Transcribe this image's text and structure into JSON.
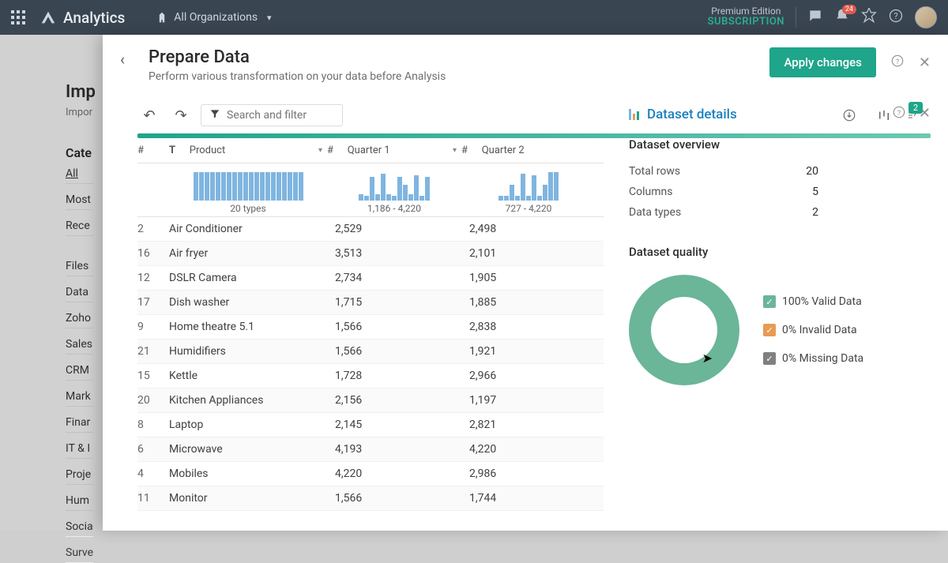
{
  "topnav": {
    "product": "Analytics",
    "org_label": "All Organizations",
    "edition_a": "Premium Edition",
    "edition_b": "SUBSCRIPTION",
    "notif_count": "24"
  },
  "bg": {
    "title": "Imp",
    "sub": "Impor",
    "cat": "Cate",
    "items": [
      "All",
      "Most",
      "Rece",
      "Files",
      "Data",
      "Zoho",
      "Sales",
      "CRM",
      "Mark",
      "Finar",
      "IT & I",
      "Proje",
      "Hum",
      "Socia",
      "Surve"
    ]
  },
  "panel": {
    "title": "Prepare Data",
    "subtitle": "Perform various transformation on your data before Analysis",
    "apply": "Apply changes",
    "search_placeholder": "Search and filter",
    "badge": "2"
  },
  "table": {
    "cols": {
      "idx": "#",
      "type": "T",
      "product": "Product",
      "q1": "Quarter 1",
      "q2": "Quarter 2"
    },
    "hist": {
      "c1": "20 types",
      "c2": "1,186 - 4,220",
      "c3": "727 - 4,220"
    },
    "rows": [
      {
        "n": "2",
        "p": "Air Conditioner",
        "q1": "2,529",
        "q2": "2,498"
      },
      {
        "n": "16",
        "p": "Air fryer",
        "q1": "3,513",
        "q2": "2,101"
      },
      {
        "n": "12",
        "p": "DSLR Camera",
        "q1": "2,734",
        "q2": "1,905"
      },
      {
        "n": "17",
        "p": "Dish washer",
        "q1": "1,715",
        "q2": "1,885"
      },
      {
        "n": "9",
        "p": "Home theatre 5.1",
        "q1": "1,566",
        "q2": "2,838"
      },
      {
        "n": "21",
        "p": "Humidifiers",
        "q1": "1,566",
        "q2": "1,921"
      },
      {
        "n": "15",
        "p": "Kettle",
        "q1": "1,728",
        "q2": "2,966"
      },
      {
        "n": "20",
        "p": "Kitchen Appliances",
        "q1": "2,156",
        "q2": "1,197"
      },
      {
        "n": "8",
        "p": "Laptop",
        "q1": "2,145",
        "q2": "2,821"
      },
      {
        "n": "6",
        "p": "Microwave",
        "q1": "4,193",
        "q2": "4,220"
      },
      {
        "n": "4",
        "p": "Mobiles",
        "q1": "4,220",
        "q2": "2,986"
      },
      {
        "n": "11",
        "p": "Monitor",
        "q1": "1,566",
        "q2": "1,744"
      }
    ]
  },
  "details": {
    "title": "Dataset details",
    "overview": "Dataset overview",
    "stats": [
      {
        "k": "Total rows",
        "v": "20"
      },
      {
        "k": "Columns",
        "v": "5"
      },
      {
        "k": "Data types",
        "v": "2"
      }
    ],
    "quality": "Dataset quality",
    "legend": [
      {
        "cls": "g",
        "txt": "100% Valid Data"
      },
      {
        "cls": "o",
        "txt": "0% Invalid Data"
      },
      {
        "cls": "gr",
        "txt": "0% Missing Data"
      }
    ]
  },
  "chart_data": {
    "type": "pie",
    "title": "Dataset quality",
    "series": [
      {
        "name": "Valid Data",
        "value": 100
      },
      {
        "name": "Invalid Data",
        "value": 0
      },
      {
        "name": "Missing Data",
        "value": 0
      }
    ]
  }
}
